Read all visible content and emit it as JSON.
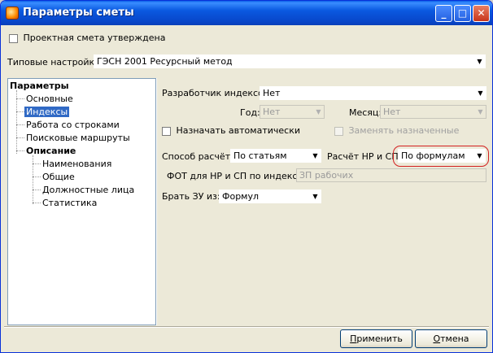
{
  "window": {
    "title": "Параметры сметы"
  },
  "approved_checkbox": {
    "label": "Проектная смета утверждена",
    "checked": false
  },
  "typical_settings": {
    "label": "Типовые настройки:",
    "value": "ГЭСН 2001 Ресурсный метод"
  },
  "tree": {
    "root": "Параметры",
    "items": [
      "Основные",
      "Индексы",
      "Работа со строками",
      "Поисковые маршруты"
    ],
    "selected": "Индексы",
    "group": "Описание",
    "sub_items": [
      "Наименования",
      "Общие",
      "Должностные лица",
      "Статистика"
    ]
  },
  "indexes": {
    "developer_label": "Разработчик индексов:",
    "developer_value": "Нет",
    "year_label": "Год:",
    "year_value": "Нет",
    "month_label": "Месяц:",
    "month_value": "Нет",
    "auto_assign_label": "Назначать автоматически",
    "auto_assign_checked": false,
    "replace_assigned_label": "Заменять назначенные",
    "replace_assigned_checked": false,
    "calc_method_label": "Способ расчёта:",
    "calc_method_value": "По статьям",
    "nr_sp_calc_label": "Расчёт НР и СП:",
    "nr_sp_calc_value": "По формулам",
    "fot_label": "ФОТ для НР и СП по индексам:",
    "fot_value": "ЗП рабочих",
    "take_zu_label": "Брать ЗУ из:",
    "take_zu_value": "Формул"
  },
  "buttons": {
    "apply": {
      "mnemonic": "П",
      "rest": "рименить"
    },
    "cancel": {
      "mnemonic": "О",
      "rest": "тмена"
    }
  },
  "colors": {
    "highlight_ring": "#d32020",
    "selection": "#316ac5",
    "title_bar": "#0a59e0"
  }
}
